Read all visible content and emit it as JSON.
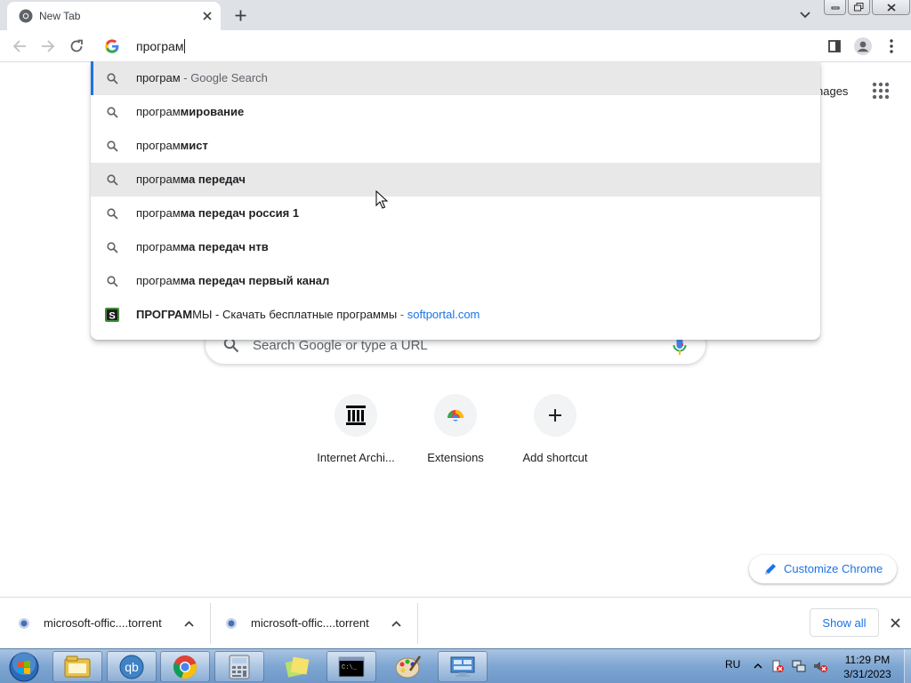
{
  "browser": {
    "tab": {
      "title": "New Tab",
      "favicon": "chrome-icon",
      "close_icon": "close-icon"
    },
    "new_tab_icon": "plus-icon",
    "tab_search_icon": "chevron-down-icon",
    "window_controls": [
      "minimize-icon",
      "restore-icon",
      "close-icon"
    ],
    "toolbar": {
      "back_icon": "arrow-left-icon",
      "forward_icon": "arrow-right-icon",
      "reload_icon": "reload-icon",
      "side_panel_icon": "side-panel-icon",
      "profile_icon": "profile-icon",
      "menu_icon": "kebab-menu-icon"
    },
    "omnibox": {
      "value": "програм",
      "provider_icon": "google-g-icon"
    }
  },
  "suggestions": [
    {
      "icon": "search-icon",
      "prefix": "програм",
      "bold": "",
      "suffix": " - Google Search",
      "url": ""
    },
    {
      "icon": "search-icon",
      "prefix": "програм",
      "bold": "мирование",
      "suffix": "",
      "url": ""
    },
    {
      "icon": "search-icon",
      "prefix": "програм",
      "bold": "мист",
      "suffix": "",
      "url": ""
    },
    {
      "icon": "search-icon",
      "prefix": "програм",
      "bold": "ма передач",
      "suffix": "",
      "url": ""
    },
    {
      "icon": "search-icon",
      "prefix": "програм",
      "bold": "ма передач россия 1",
      "suffix": "",
      "url": ""
    },
    {
      "icon": "search-icon",
      "prefix": "програм",
      "bold": "ма передач нтв",
      "suffix": "",
      "url": ""
    },
    {
      "icon": "search-icon",
      "prefix": "програм",
      "bold": "ма передач первый канал",
      "suffix": "",
      "url": ""
    },
    {
      "icon": "softportal-icon",
      "prefix": "",
      "bold": "ПРОГРАМ",
      "suffix": "МЫ - Скачать бесплатные программы",
      "url": "softportal.com"
    }
  ],
  "ntp": {
    "images_link": "Images",
    "images_link_visible": "nages",
    "apps_icon": "apps-grid-icon",
    "search_placeholder": "Search Google or type a URL",
    "search_icon": "search-icon",
    "mic_icon": "microphone-icon",
    "shortcuts": [
      {
        "label": "Internet Archi...",
        "icon": "archive-icon"
      },
      {
        "label": "Extensions",
        "icon": "chrome-web-store-icon"
      },
      {
        "label": "Add shortcut",
        "icon": "plus-icon"
      }
    ],
    "customize_label": "Customize Chrome",
    "customize_icon": "pencil-icon"
  },
  "downloads": {
    "items": [
      {
        "name": "microsoft-offic....torrent",
        "icon": "torrent-file-icon"
      },
      {
        "name": "microsoft-offic....torrent",
        "icon": "torrent-file-icon"
      }
    ],
    "show_all": "Show all",
    "close_icon": "close-icon"
  },
  "taskbar": {
    "apps": [
      "explorer-icon",
      "qbittorrent-icon",
      "chrome-icon",
      "calculator-icon",
      "sticky-notes-icon",
      "cmd-icon",
      "paint-icon",
      "remote-desktop-icon"
    ],
    "language": "RU",
    "time": "11:29 PM",
    "date": "3/31/2023"
  },
  "colors": {
    "accent": "#1a73e8",
    "tabstrip": "#dee1e6",
    "highlight": "#e8e8e9"
  }
}
